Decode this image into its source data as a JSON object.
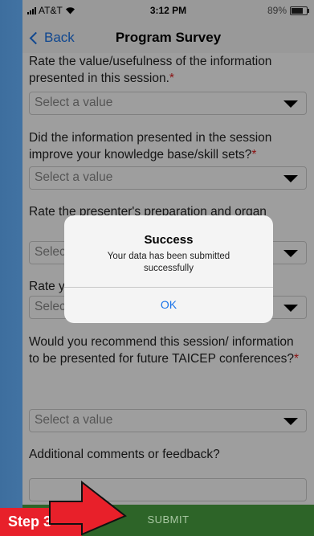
{
  "status_bar": {
    "carrier": "AT&T",
    "time": "3:12 PM",
    "battery": "89%",
    "battery_level": 0.89
  },
  "nav": {
    "back_label": "Back",
    "title": "Program Survey"
  },
  "form": {
    "questions": [
      {
        "text": "Rate the value/usefulness of the information presented in this session.",
        "required_mark": "*",
        "select_placeholder": "Select a value"
      },
      {
        "text": "Did the information presented in the session improve your knowledge base/skill sets?",
        "required_mark": "*",
        "select_placeholder": "Select a value"
      },
      {
        "text": "Rate the presenter's preparation and organ",
        "required_mark": "",
        "select_placeholder": "Select a value"
      },
      {
        "text": "Rate your",
        "required_mark": "",
        "select_placeholder": "Select a value"
      },
      {
        "text": "Would you recommend this session/ information to be presented for future TAICEP conferences?",
        "required_mark": "*",
        "select_placeholder": "Select a value"
      }
    ],
    "comments_label": "Additional comments or feedback?",
    "comments_value": ""
  },
  "dialog": {
    "title": "Success",
    "message": "Your data has been submitted successfully",
    "ok_label": "OK"
  },
  "submit_label": "SUBMIT",
  "annotation": {
    "label": "Step 3"
  },
  "colors": {
    "accent": "#1a73e8",
    "required": "#e02020",
    "submit_bar": "#2d6428",
    "annotation": "#e8202a"
  }
}
